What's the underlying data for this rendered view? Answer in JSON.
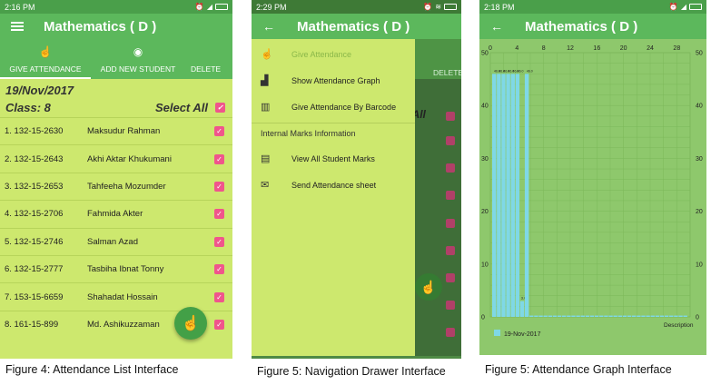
{
  "panel1": {
    "status_time": "2:16 PM",
    "title": "Mathematics ( D )",
    "tabs": [
      "GIVE ATTENDANCE",
      "ADD NEW STUDENT",
      "DELETE"
    ],
    "date": "19/Nov/2017",
    "class_label": "Class:  8",
    "select_all": "Select All",
    "students": [
      {
        "id": "1. 132-15-2630",
        "name": "Maksudur Rahman"
      },
      {
        "id": "2. 132-15-2643",
        "name": "Akhi Aktar Khukumani"
      },
      {
        "id": "3. 132-15-2653",
        "name": "Tahfeeha Mozumder"
      },
      {
        "id": "4. 132-15-2706",
        "name": "Fahmida Akter"
      },
      {
        "id": "5. 132-15-2746",
        "name": "Salman Azad"
      },
      {
        "id": "6. 132-15-2777",
        "name": "Tasbiha Ibnat Tonny"
      },
      {
        "id": "7. 153-15-6659",
        "name": "Shahadat Hossain"
      },
      {
        "id": "8. 161-15-899",
        "name": "Md. Ashikuzzaman"
      }
    ],
    "caption": "Figure 4: Attendance List Interface"
  },
  "panel2": {
    "status_time": "2:29 PM",
    "title": "Mathematics ( D )",
    "drawer_items": [
      {
        "icon": "hand-pointer-icon",
        "label": "Give Attendance"
      },
      {
        "icon": "bar-chart-icon",
        "label": "Show Attendance Graph"
      },
      {
        "icon": "barcode-icon",
        "label": "Give Attendance By Barcode"
      }
    ],
    "section_header": "Internal Marks Information",
    "section_items": [
      {
        "icon": "clipboard-icon",
        "label": "View All Student Marks"
      },
      {
        "icon": "email-icon",
        "label": "Send Attendance sheet"
      }
    ],
    "behind_tab": "DELETE",
    "behind_text": "ct All",
    "caption": "Figure 5: Navigation Drawer Interface"
  },
  "panel3": {
    "status_time": "2:18 PM",
    "title": "Mathematics ( D )",
    "caption": "Figure 5: Attendance Graph Interface"
  },
  "colors": {
    "green": "#5cb85c",
    "light": "#cde86e",
    "pink": "#f0558c",
    "bar": "#7fd8e6"
  },
  "chart_data": {
    "type": "bar",
    "title": "",
    "xlabel": "Description",
    "ylabel": "",
    "xlim": [
      0,
      30
    ],
    "ylim": [
      0,
      50
    ],
    "x_ticks": [
      "0",
      "4",
      "8",
      "12",
      "16",
      "20",
      "24",
      "28"
    ],
    "y_ticks": [
      "0",
      "10",
      "20",
      "30",
      "40",
      "50"
    ],
    "legend": "19-Nov-2017",
    "legend_placement": "bottom-left",
    "grid": true,
    "bar_labels": [
      "46.0",
      "46.0",
      "46.0",
      "46.0",
      "46.0",
      "46.0",
      "46.0",
      "46.0"
    ],
    "small_label": "3.0",
    "values": [
      46,
      46,
      46,
      46,
      46,
      46,
      3,
      46,
      0,
      0,
      0,
      0,
      0,
      0,
      0,
      0,
      0,
      0,
      0,
      0,
      0,
      0,
      0,
      0,
      0,
      0,
      0,
      0,
      0,
      0,
      0,
      0,
      0,
      0,
      0,
      0,
      0,
      0,
      0,
      0,
      0,
      0
    ]
  }
}
